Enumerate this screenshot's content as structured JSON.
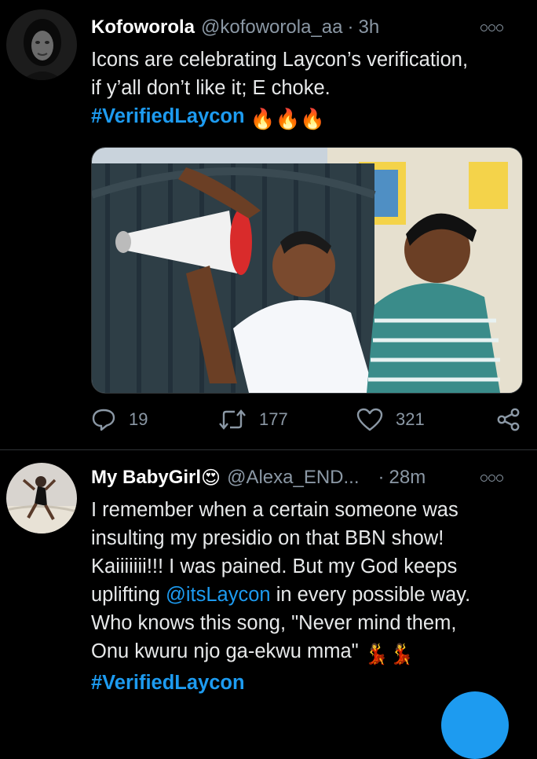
{
  "tweets": [
    {
      "name": "Kofoworola",
      "handle": "@kofoworola_aa",
      "separator": "·",
      "time": "3h",
      "text_line1": "Icons are celebrating Laycon’s verification,",
      "text_line2": "if y’all don’t like it; E choke.",
      "hashtag": "#VerifiedLaycon",
      "emoji": "🔥🔥🔥",
      "replies": "19",
      "retweets": "177",
      "likes": "321"
    },
    {
      "name": "My BabyGirl",
      "name_emoji": "😍",
      "handle": "@Alexa_END...",
      "separator": "·",
      "time": "28m",
      "line1": "I remember when a certain someone was",
      "line2": "insulting my presidio on that BBN show!",
      "line3": "Kaiiiiiii!!! I was pained. But my God keeps",
      "line4_before": "uplifting ",
      "mention": "@itsLaycon",
      "line4_after": " in every possible way.",
      "line5": "Who knows this song, \"Never mind them,",
      "line6": "Onu kwuru njo ga-ekwu mma\" ",
      "line6_emoji": "💃💃",
      "hashtag": "#VerifiedLaycon"
    }
  ],
  "icons": {
    "reply": "reply-icon",
    "retweet": "retweet-icon",
    "like": "heart-icon",
    "share": "share-icon",
    "more": "more-options-icon"
  },
  "colors": {
    "background": "#000000",
    "link": "#1d9bf0",
    "secondary": "#8b98a5",
    "divider": "#2f3336"
  }
}
